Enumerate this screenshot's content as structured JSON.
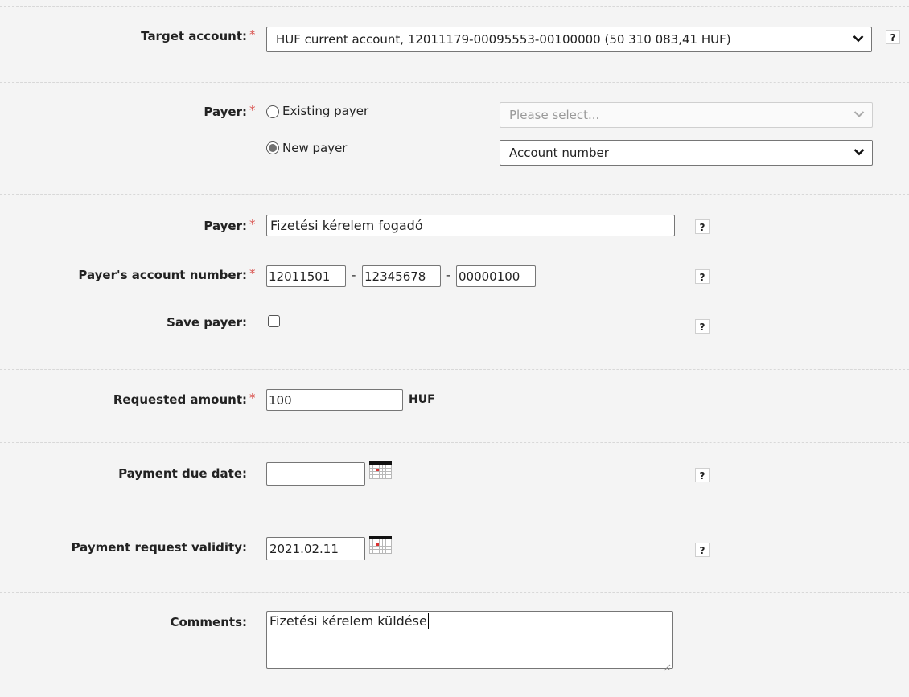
{
  "form": {
    "target_account": {
      "label": "Target account:",
      "required_mark": "*",
      "selected": "HUF current account, 12011179-00095553-00100000 (50 310 083,41 HUF)",
      "help": "?"
    },
    "payer_choice": {
      "label": "Payer:",
      "required_mark": "*",
      "existing_label": "Existing payer",
      "new_label": "New payer",
      "existing_select_placeholder": "Please select...",
      "new_select_value": "Account number",
      "selected": "new"
    },
    "payer_name": {
      "label": "Payer:",
      "required_mark": "*",
      "value": "Fizetési kérelem fogadó",
      "help": "?"
    },
    "payer_account": {
      "label": "Payer's account number:",
      "required_mark": "*",
      "part1": "12011501",
      "part2": "12345678",
      "part3": "00000100",
      "separator": "-",
      "help": "?"
    },
    "save_payer": {
      "label": "Save payer:",
      "checked": false,
      "help": "?"
    },
    "requested_amount": {
      "label": "Requested amount:",
      "required_mark": "*",
      "value": "100",
      "currency": "HUF"
    },
    "payment_due_date": {
      "label": "Payment due date:",
      "value": "",
      "help": "?"
    },
    "request_validity": {
      "label": "Payment request validity:",
      "value": "2021.02.11",
      "help": "?"
    },
    "comments": {
      "label": "Comments:",
      "value": "Fizetési kérelem küldése"
    }
  },
  "colors": {
    "background": "#f4f4f4",
    "required": "#d9534f",
    "separator": "#d8d8d8"
  }
}
